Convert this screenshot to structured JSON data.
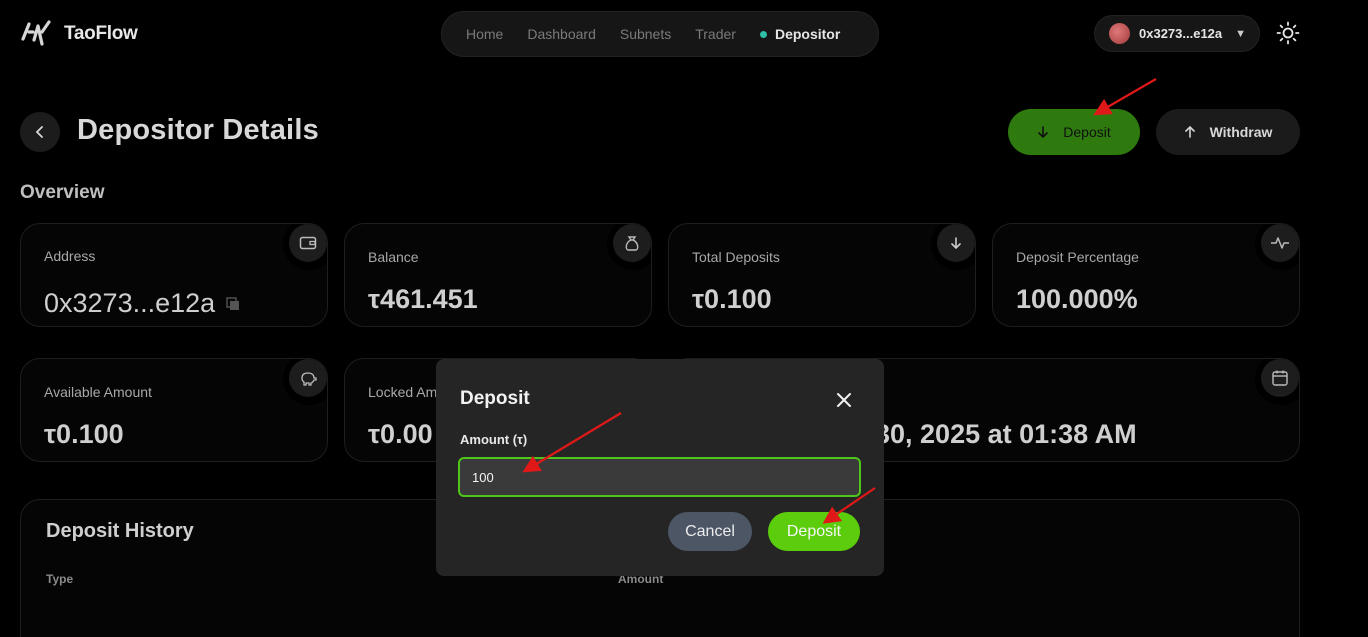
{
  "brand": {
    "name": "TaoFlow"
  },
  "nav": {
    "items": [
      {
        "label": "Home"
      },
      {
        "label": "Dashboard"
      },
      {
        "label": "Subnets"
      },
      {
        "label": "Trader"
      },
      {
        "label": "Depositor"
      }
    ],
    "active": "Depositor"
  },
  "wallet": {
    "address": "0x3273...e12a"
  },
  "page": {
    "title": "Depositor Details",
    "section": "Overview"
  },
  "actions": {
    "deposit_label": "Deposit",
    "withdraw_label": "Withdraw"
  },
  "cards": {
    "address": {
      "label": "Address",
      "value": "0x3273...e12a"
    },
    "balance": {
      "label": "Balance",
      "value": "τ461.451"
    },
    "total_deposits": {
      "label": "Total Deposits",
      "value": "τ0.100"
    },
    "deposit_percentage": {
      "label": "Deposit Percentage",
      "value": "100.000%"
    },
    "available": {
      "label": "Available Amount",
      "value": "τ0.100"
    },
    "locked": {
      "label": "Locked Am",
      "value": "τ0.00"
    },
    "date": {
      "value": "30, 2025 at 01:38 AM"
    }
  },
  "history": {
    "title": "Deposit History",
    "columns": [
      "Type",
      "Amount"
    ]
  },
  "modal": {
    "title": "Deposit",
    "amount_label": "Amount (τ)",
    "amount_value": "100",
    "cancel_label": "Cancel",
    "submit_label": "Deposit"
  },
  "colors": {
    "accent_green": "#5ccd0c",
    "deposit_button": "#2e7a0e",
    "annotation_arrow": "#e01818",
    "active_dot": "#2dbfa7"
  }
}
